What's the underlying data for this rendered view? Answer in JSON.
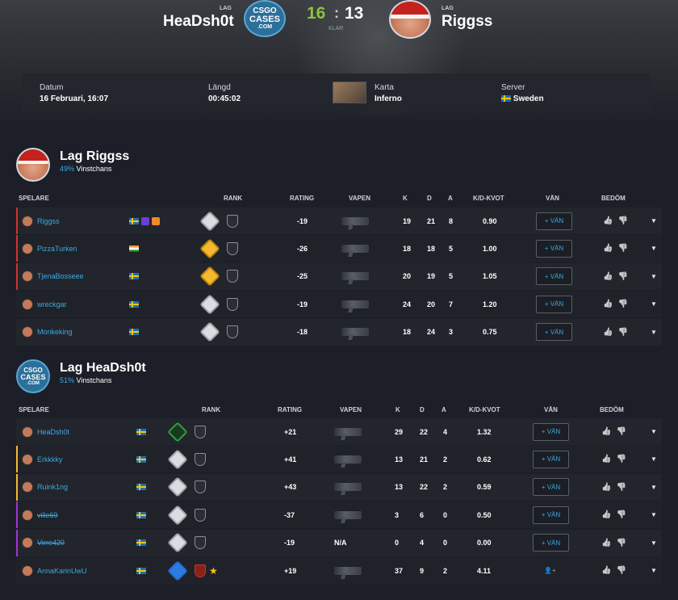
{
  "header": {
    "team_left_label": "LAG",
    "team_left_name": "HeaDsh0t",
    "team_right_label": "LAG",
    "team_right_name": "Riggss",
    "score_left": "16",
    "score_sep": ":",
    "score_right": "13",
    "status": "KLAR",
    "logo_text": [
      "CSGO",
      "CASES",
      ".COM"
    ]
  },
  "info": {
    "date_label": "Datum",
    "date_value": "16 Februari, 16:07",
    "length_label": "Längd",
    "length_value": "00:45:02",
    "map_label": "Karta",
    "map_value": "Inferno",
    "server_label": "Server",
    "server_value": "Sweden"
  },
  "columns": {
    "player": "SPELARE",
    "rank": "RANK",
    "rating": "RATING",
    "weapon": "VAPEN",
    "k": "K",
    "d": "D",
    "a": "A",
    "kd": "K/D-KVOT",
    "friend": "VÄN",
    "rate": "BEDÖM"
  },
  "team1": {
    "name": "Lag Riggss",
    "win_pct": "49%",
    "win_label": "Vinstchans",
    "players": [
      {
        "name": "Riggss",
        "rating": "-19",
        "k": "19",
        "d": "21",
        "a": "8",
        "kd": "0.90",
        "friend": "+ VÄN",
        "rank": "silver",
        "flags": [
          "se"
        ],
        "badges": true
      },
      {
        "name": "PizzaTurken",
        "rating": "-26",
        "k": "18",
        "d": "18",
        "a": "5",
        "kd": "1.00",
        "friend": "+ VÄN",
        "rank": "gold",
        "flags": [
          "in"
        ]
      },
      {
        "name": "TjenaBosseee",
        "rating": "-25",
        "k": "20",
        "d": "19",
        "a": "5",
        "kd": "1.05",
        "friend": "+ VÄN",
        "rank": "gold",
        "flags": [
          "se"
        ]
      },
      {
        "name": "wreckgar",
        "rating": "-19",
        "k": "24",
        "d": "20",
        "a": "7",
        "kd": "1.20",
        "friend": "+ VÄN",
        "rank": "silver",
        "flags": [
          "se"
        ]
      },
      {
        "name": "Monkeking",
        "rating": "-18",
        "k": "18",
        "d": "24",
        "a": "3",
        "kd": "0.75",
        "friend": "+ VÄN",
        "rank": "silver",
        "flags": [
          "se"
        ]
      }
    ]
  },
  "team2": {
    "name": "Lag HeaDsh0t",
    "win_pct": "51%",
    "win_label": "Vinstchans",
    "players": [
      {
        "name": "HeaDsh0t",
        "rating": "+21",
        "k": "29",
        "d": "22",
        "a": "4",
        "kd": "1.32",
        "friend": "+ VÄN",
        "rank": "green",
        "flags": [
          "se"
        ]
      },
      {
        "name": "Erkkkky",
        "rating": "+41",
        "k": "13",
        "d": "21",
        "a": "2",
        "kd": "0.62",
        "friend": "+ VÄN",
        "rank": "silver",
        "flags": [
          "se"
        ]
      },
      {
        "name": "Ruink1ng",
        "rating": "+43",
        "k": "13",
        "d": "22",
        "a": "2",
        "kd": "0.59",
        "friend": "+ VÄN",
        "rank": "silver",
        "flags": [
          "se"
        ]
      },
      {
        "name": "ville69",
        "rating": "-37",
        "k": "3",
        "d": "6",
        "a": "0",
        "kd": "0.50",
        "friend": "+ VÄN",
        "rank": "silver",
        "flags": [
          "se"
        ],
        "strike": true
      },
      {
        "name": "Virre420",
        "rating": "-19",
        "weapon": "N/A",
        "k": "0",
        "d": "4",
        "a": "0",
        "kd": "0.00",
        "friend": "+ VÄN",
        "rank": "silver",
        "flags": [
          "se"
        ],
        "strike": true
      },
      {
        "name": "AnnaKarinUwU",
        "rating": "+19",
        "k": "37",
        "d": "9",
        "a": "2",
        "kd": "4.11",
        "friend": "",
        "rank": "blue",
        "flags": [
          "se"
        ],
        "star": true
      }
    ]
  },
  "colors": {
    "accent": "#3fa8e4",
    "score_win": "#8cc43c",
    "background": "#1c1f27"
  }
}
